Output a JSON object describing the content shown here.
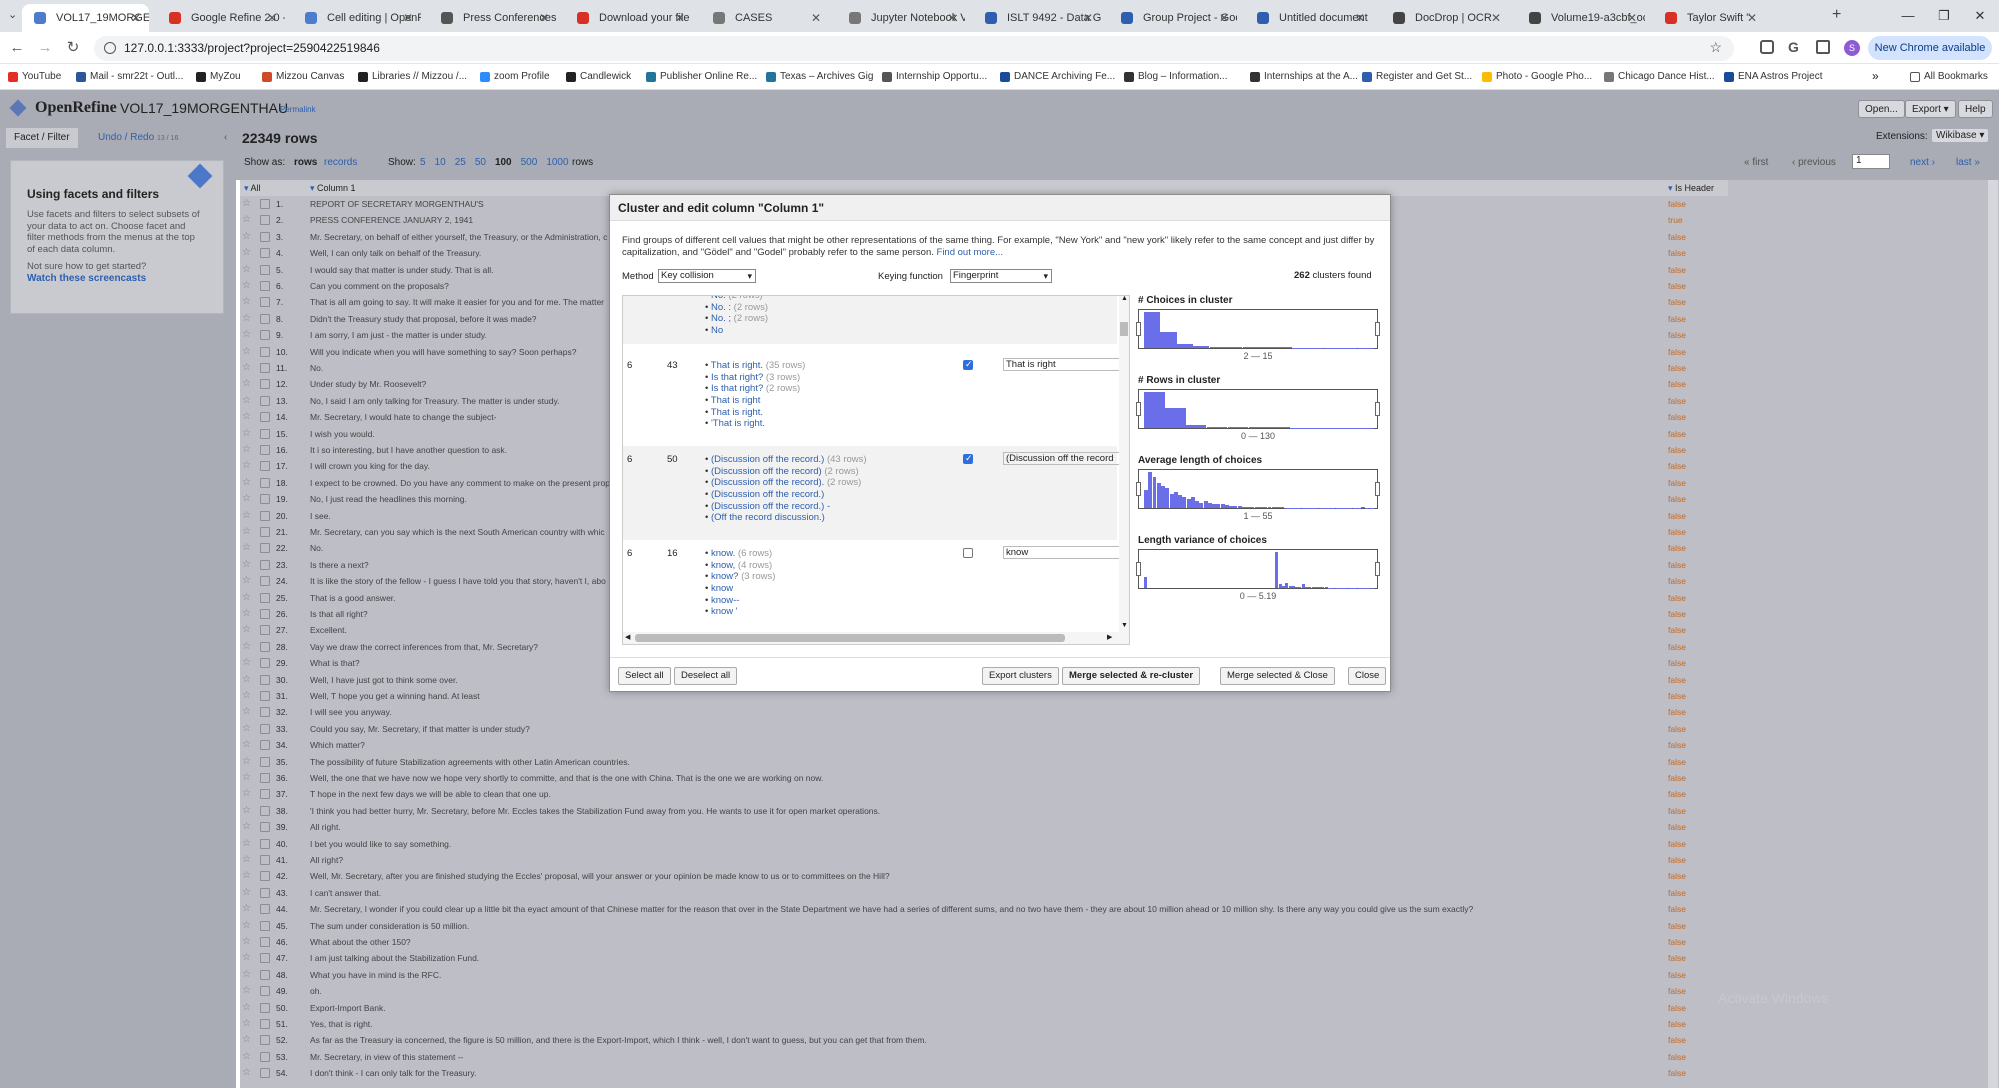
{
  "browser": {
    "tabs": [
      {
        "title": "VOL17_19MORGENT",
        "color": "#4c7ccc",
        "active": true
      },
      {
        "title": "Google Refine 2.0 -",
        "color": "#d93025"
      },
      {
        "title": "Cell editing | OpenR",
        "color": "#4c7ccc"
      },
      {
        "title": "Press Conferences of",
        "color": "#555555"
      },
      {
        "title": "Download your file",
        "color": "#d93025"
      },
      {
        "title": "CASES",
        "color": "#777777"
      },
      {
        "title": "Jupyter Notebook V",
        "color": "#777777"
      },
      {
        "title": "ISLT 9492 - Data Gr",
        "color": "#2d5fae"
      },
      {
        "title": "Group Project - Goo",
        "color": "#2d5fae"
      },
      {
        "title": "Untitled document",
        "color": "#2d5fae"
      },
      {
        "title": "DocDrop | OCR",
        "color": "#444444"
      },
      {
        "title": "Volume19-a3cbf_oc",
        "color": "#444444"
      },
      {
        "title": "Taylor Swift \"",
        "color": "#d93025"
      }
    ],
    "url": "127.0.0.1:3333/project?project=2590422519846",
    "new_chrome": "New Chrome available",
    "bookmarks": [
      {
        "label": "YouTube",
        "color": "#e52d27"
      },
      {
        "label": "Mail - smr22t - Outl...",
        "color": "#2b579a"
      },
      {
        "label": "MyZou",
        "color": "#222222"
      },
      {
        "label": "Mizzou Canvas",
        "color": "#d14a28"
      },
      {
        "label": "Libraries // Mizzou /...",
        "color": "#222222"
      },
      {
        "label": "zoom Profile",
        "color": "#2d8cff"
      },
      {
        "label": "Candlewick",
        "color": "#222222"
      },
      {
        "label": "Publisher Online Re...",
        "color": "#21759b"
      },
      {
        "label": "Texas – Archives Gig",
        "color": "#21759b"
      },
      {
        "label": "Internship Opportu...",
        "color": "#555555"
      },
      {
        "label": "DANCE Archiving Fe...",
        "color": "#1a4b9b"
      },
      {
        "label": "Blog – Information...",
        "color": "#333333"
      },
      {
        "label": "Internships at the A...",
        "color": "#333333"
      },
      {
        "label": "Register and Get St...",
        "color": "#2d5fae"
      },
      {
        "label": "Photo - Google Pho...",
        "color": "#fbbc04"
      },
      {
        "label": "Chicago Dance Hist...",
        "color": "#777777"
      },
      {
        "label": "ENA Astros Project",
        "color": "#1a4b9b"
      }
    ],
    "all_bookmarks": "All Bookmarks"
  },
  "app": {
    "name": "OpenRefine",
    "project": "VOL17_19MORGENTHAU",
    "permalink": "Permalink",
    "open": "Open...",
    "export": "Export ▾",
    "help": "Help",
    "extensions": "Extensions:",
    "wikibase": "Wikibase ▾"
  },
  "left": {
    "tab_facet": "Facet / Filter",
    "tab_undo": "Undo / Redo",
    "undo_count": "13 / 16",
    "heading": "Using facets and filters",
    "p1": "Use facets and filters to select subsets of your data to act on. Choose facet and filter methods from the menus at the top of each data column.",
    "p2": "Not sure how to get started?",
    "link": "Watch these screencasts"
  },
  "toolbar": {
    "rows": "22349 rows",
    "show_as": "Show as:",
    "rows_mode": "rows",
    "records_mode": "records",
    "show": "Show:",
    "sizes": [
      "5",
      "10",
      "25",
      "50",
      "100",
      "500",
      "1000"
    ],
    "rows_suffix": "rows",
    "first": "« first",
    "previous": "‹ previous",
    "page": "1",
    "next": "next ›",
    "last": "last »"
  },
  "columns": {
    "all": "All",
    "col1": "Column 1",
    "is_header": "Is Header"
  },
  "rows": [
    {
      "n": "1.",
      "text": "REPORT OF SECRETARY MORGENTHAU'S",
      "h": "false"
    },
    {
      "n": "2.",
      "text": "PRESS CONFERENCE JANUARY 2, 1941",
      "h": "true"
    },
    {
      "n": "3.",
      "text": "Mr. Secretary, on behalf of either yourself, the Treasury, or the Administration, c",
      "h": "false"
    },
    {
      "n": "4.",
      "text": "Well, I can only talk on behalf of the Treasury.",
      "h": "false"
    },
    {
      "n": "5.",
      "text": "I would say that matter is under study. That is all.",
      "h": "false"
    },
    {
      "n": "6.",
      "text": "Can you comment on the proposals?",
      "h": "false"
    },
    {
      "n": "7.",
      "text": "That is all am going to say. It will make it easier for you and for me. The matter",
      "h": "false"
    },
    {
      "n": "8.",
      "text": "Didn't the Treasury study that proposal, before it was made?",
      "h": "false"
    },
    {
      "n": "9.",
      "text": "I am sorry, I am just - the matter is under study.",
      "h": "false"
    },
    {
      "n": "10.",
      "text": "Will you indicate when you will have something to say? Soon perhaps?",
      "h": "false"
    },
    {
      "n": "11.",
      "text": "No.",
      "h": "false"
    },
    {
      "n": "12.",
      "text": "Under study by Mr. Roosevelt?",
      "h": "false"
    },
    {
      "n": "13.",
      "text": "No, I said I am only talking for Treasury. The matter is under study.",
      "h": "false"
    },
    {
      "n": "14.",
      "text": " Mr. Secretary, I would hate to change the subject-",
      "h": "false"
    },
    {
      "n": "15.",
      "text": "I wish you would.",
      "h": "false"
    },
    {
      "n": "16.",
      "text": "It i so interesting, but I have another question to ask.",
      "h": "false"
    },
    {
      "n": "17.",
      "text": "I will crown you king for the day.",
      "h": "false"
    },
    {
      "n": "18.",
      "text": "I expect to be crowned. Do you have any comment to make on the present prop",
      "h": "false"
    },
    {
      "n": "19.",
      "text": "No, I just read the headlines this morning.",
      "h": "false"
    },
    {
      "n": "20.",
      "text": "I see.",
      "h": "false"
    },
    {
      "n": "21.",
      "text": "Mr. Secretary, can you say which is the next South American country with whic",
      "h": "false"
    },
    {
      "n": "22.",
      "text": "No.",
      "h": "false"
    },
    {
      "n": "23.",
      "text": "Is there a next?",
      "h": "false"
    },
    {
      "n": "24.",
      "text": "It is like the story of the fellow - I guess I have told you that story, haven't I, abo",
      "h": "false"
    },
    {
      "n": "25.",
      "text": "That is a good answer.",
      "h": "false"
    },
    {
      "n": "26.",
      "text": "Is that all right?",
      "h": "false"
    },
    {
      "n": "27.",
      "text": "Excellent.",
      "h": "false"
    },
    {
      "n": "28.",
      "text": "Vay we draw the correct inferences from that, Mr. Secretary?",
      "h": "false"
    },
    {
      "n": "29.",
      "text": "What is that?",
      "h": "false"
    },
    {
      "n": "30.",
      "text": "Well, I have just got to think some over.",
      "h": "false"
    },
    {
      "n": "31.",
      "text": "Well, T hope you get a winning hand. At least",
      "h": "false"
    },
    {
      "n": "32.",
      "text": "I will see you anyway.",
      "h": "false"
    },
    {
      "n": "33.",
      "text": "Could you say, Mr. Secretary, if that matter is under study?",
      "h": "false"
    },
    {
      "n": "34.",
      "text": "Which matter?",
      "h": "false"
    },
    {
      "n": "35.",
      "text": "The possibility of future Stabilization agreements with other Latin American countries.",
      "h": "false"
    },
    {
      "n": "36.",
      "text": "Well, the one that we have now we hope very shortly to committe, and that is the one with China. That is the one we are working on now.",
      "h": "false"
    },
    {
      "n": "37.",
      "text": "T hope in the next few days we will be able to clean that one up.",
      "h": "false"
    },
    {
      "n": "38.",
      "text": "'I think you had better hurry, Mr. Secretary, before Mr. Eccles takes the Stabilization Fund away from you. He wants to use it for open market operations.",
      "h": "false"
    },
    {
      "n": "39.",
      "text": "All right.",
      "h": "false"
    },
    {
      "n": "40.",
      "text": "I bet you would like to say something.",
      "h": "false"
    },
    {
      "n": "41.",
      "text": "All right?",
      "h": "false"
    },
    {
      "n": "42.",
      "text": "Well, Mr. Secretary, after you are finished studying the Eccles' proposal, will your answer or your opinion be made know to us or to committees on the Hill?",
      "h": "false"
    },
    {
      "n": "43.",
      "text": "I can't answer that.",
      "h": "false"
    },
    {
      "n": "44.",
      "text": "Mr. Secretary, I wonder if you could clear up a little bit tha eyact amount of that Chinese matter for the reason that over in the State Department we have had a series of different sums, and no two have them - they are about 10 million ahead or 10 million shy. Is there any way you could give us the sum exactly?",
      "h": "false"
    },
    {
      "n": "45.",
      "text": "The sum under consideration is 50 million.",
      "h": "false"
    },
    {
      "n": "46.",
      "text": "What about the other 150?",
      "h": "false"
    },
    {
      "n": "47.",
      "text": "I am just talking about the Stabilization Fund.",
      "h": "false"
    },
    {
      "n": "48.",
      "text": "What you have in mind is the RFC.",
      "h": "false"
    },
    {
      "n": "49.",
      "text": "oh.",
      "h": "false"
    },
    {
      "n": "50.",
      "text": "Export-Import Bank.",
      "h": "false"
    },
    {
      "n": "51.",
      "text": "Yes, that is right.",
      "h": "false"
    },
    {
      "n": "52.",
      "text": "As far as the Treasury ia concerned, the figure is 50 million, and there is the Export-Import, which I think - well, I don't want to guess, but you can get that from them.",
      "h": "false"
    },
    {
      "n": "53.",
      "text": "Mr. Secretary, in view of this statement --",
      "h": "false"
    },
    {
      "n": "54.",
      "text": "I don't think - I can only talk for the Treasury.",
      "h": "false"
    }
  ],
  "modal": {
    "title": "Cluster and edit column \"Column 1\"",
    "desc": "Find groups of different cell values that might be other representations of the same thing. For example, \"New York\" and \"new york\" likely refer to the same concept and just differ by capitalization, and \"Gödel\" and \"Godel\" probably refer to the same person.",
    "find_more": "Find out more...",
    "method_label": "Method",
    "method": "Key collision",
    "keying_label": "Keying function",
    "keying": "Fingerprint",
    "clusters_count": "262",
    "clusters_label": "clusters found",
    "partial": [
      {
        "v": "No.",
        "r": "(2 rows)"
      },
      {
        "v": "No. :",
        "r": "(2 rows)"
      },
      {
        "v": "No. ;",
        "r": "(2 rows)"
      },
      {
        "v": "No",
        "r": ""
      }
    ],
    "clusters": [
      {
        "size": "6",
        "rows": "43",
        "checked": true,
        "new_value": "That is right",
        "values": [
          {
            "v": "That is right.",
            "r": "(35 rows)"
          },
          {
            "v": "Is that right?",
            "r": "(3 rows)"
          },
          {
            "v": "Is that right?",
            "r": "(2 rows)"
          },
          {
            "v": " That is right",
            "r": ""
          },
          {
            "v": "That is right.",
            "r": ""
          },
          {
            "v": "'That is right.",
            "r": ""
          }
        ]
      },
      {
        "size": "6",
        "rows": "50",
        "checked": true,
        "new_value": "(Discussion off the record",
        "values": [
          {
            "v": "(Discussion off the record.)",
            "r": "(43 rows)"
          },
          {
            "v": "(Discussion off the record)",
            "r": "(2 rows)"
          },
          {
            "v": "(Discussion off the record).",
            "r": "(2 rows)"
          },
          {
            "v": " (Discussion off the record.)",
            "r": ""
          },
          {
            "v": "(Discussion off the record.) -",
            "r": ""
          },
          {
            "v": "(Off the record discussion.)",
            "r": ""
          }
        ]
      },
      {
        "size": "6",
        "rows": "16",
        "checked": false,
        "new_value": "know",
        "values": [
          {
            "v": "know.",
            "r": "(6 rows)"
          },
          {
            "v": "know,",
            "r": "(4 rows)"
          },
          {
            "v": "know?",
            "r": "(3 rows)"
          },
          {
            "v": "know",
            "r": ""
          },
          {
            "v": "know--",
            "r": ""
          },
          {
            "v": "know '",
            "r": ""
          }
        ]
      }
    ],
    "facets": [
      {
        "title": "# Choices in cluster",
        "range": "2 — 15",
        "bars": [
          1,
          0.45,
          0.12,
          0.05,
          0.04,
          0.03,
          0.02,
          0.02,
          0.02,
          0.01,
          0.01,
          0.01,
          0.01,
          0.01
        ]
      },
      {
        "title": "# Rows in cluster",
        "range": "0 — 130",
        "bars": [
          1,
          0.55,
          0.08,
          0.04,
          0.03,
          0.02,
          0.02,
          0.01,
          0.01,
          0.01,
          0.01
        ]
      },
      {
        "title": "Average length of choices",
        "range": "1 — 55",
        "bars": [
          0.5,
          1,
          0.85,
          0.7,
          0.6,
          0.55,
          0.4,
          0.45,
          0.35,
          0.3,
          0.25,
          0.3,
          0.2,
          0.15,
          0.2,
          0.15,
          0.1,
          0.12,
          0.1,
          0.08,
          0.06,
          0.05,
          0.05,
          0.04,
          0.04,
          0.03,
          0.03,
          0.02,
          0.02,
          0.02,
          0.02,
          0.02,
          0.02,
          0.01,
          0.01,
          0.01,
          0.01,
          0.01,
          0.01,
          0.01,
          0.01,
          0.01,
          0.01,
          0.01,
          0.01,
          0.01,
          0.01,
          0.01,
          0.01,
          0.01,
          0.01,
          0.02,
          0.01,
          0.01
        ]
      },
      {
        "title": "Length variance of choices",
        "range": "0 — 5.19",
        "bars": [
          0.3,
          0,
          0,
          0,
          0,
          0,
          0,
          0,
          0,
          0,
          0,
          0,
          0,
          0,
          0,
          0,
          0,
          0,
          0,
          0,
          0,
          0,
          0,
          0,
          0,
          0,
          0,
          0,
          0,
          0,
          0,
          0,
          0,
          0,
          0,
          0,
          0,
          0,
          0,
          0,
          1,
          0.1,
          0.05,
          0.15,
          0.05,
          0.05,
          0.03,
          0.03,
          0.1,
          0.02,
          0.02,
          0.02,
          0.02,
          0.02,
          0.02,
          0.02,
          0.01,
          0.01,
          0.01,
          0.01,
          0.01,
          0.01,
          0.01,
          0.01,
          0.01,
          0.01,
          0.01,
          0.01,
          0.01,
          0.01
        ]
      }
    ],
    "buttons": {
      "select_all": "Select all",
      "deselect_all": "Deselect all",
      "export": "Export clusters",
      "merge_recluster": "Merge selected & re-cluster",
      "merge_close": "Merge selected & Close",
      "close": "Close"
    }
  },
  "watermark": "Activate Windows"
}
